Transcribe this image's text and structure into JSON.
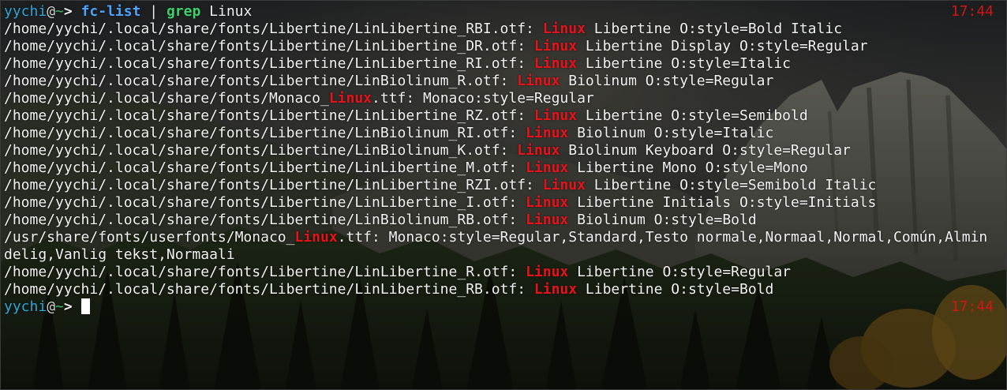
{
  "prompt": {
    "user": "yychi",
    "at": "@",
    "dir": "~",
    "arrow": ">"
  },
  "command": {
    "name": "fc-list",
    "pipe": "|",
    "grep": "grep",
    "arg": "Linux"
  },
  "clock_top": "17:44",
  "clock_bottom": "17:44",
  "output": [
    {
      "pre": "/home/yychi/.local/share/fonts/Libertine/LinLibertine_RBI.otf: ",
      "match": "Linux",
      "post": " Libertine O:style=Bold Italic"
    },
    {
      "pre": "/home/yychi/.local/share/fonts/Libertine/LinLibertine_DR.otf: ",
      "match": "Linux",
      "post": " Libertine Display O:style=Regular"
    },
    {
      "pre": "/home/yychi/.local/share/fonts/Libertine/LinLibertine_RI.otf: ",
      "match": "Linux",
      "post": " Libertine O:style=Italic"
    },
    {
      "pre": "/home/yychi/.local/share/fonts/Libertine/LinBiolinum_R.otf: ",
      "match": "Linux",
      "post": " Biolinum O:style=Regular"
    },
    {
      "pre": "/home/yychi/.local/share/fonts/Monaco_",
      "match": "Linux",
      "post": ".ttf: Monaco:style=Regular"
    },
    {
      "pre": "/home/yychi/.local/share/fonts/Libertine/LinLibertine_RZ.otf: ",
      "match": "Linux",
      "post": " Libertine O:style=Semibold"
    },
    {
      "pre": "/home/yychi/.local/share/fonts/Libertine/LinBiolinum_RI.otf: ",
      "match": "Linux",
      "post": " Biolinum O:style=Italic"
    },
    {
      "pre": "/home/yychi/.local/share/fonts/Libertine/LinBiolinum_K.otf: ",
      "match": "Linux",
      "post": " Biolinum Keyboard O:style=Regular"
    },
    {
      "pre": "/home/yychi/.local/share/fonts/Libertine/LinLibertine_M.otf: ",
      "match": "Linux",
      "post": " Libertine Mono O:style=Mono"
    },
    {
      "pre": "/home/yychi/.local/share/fonts/Libertine/LinLibertine_RZI.otf: ",
      "match": "Linux",
      "post": " Libertine O:style=Semibold Italic"
    },
    {
      "pre": "/home/yychi/.local/share/fonts/Libertine/LinLibertine_I.otf: ",
      "match": "Linux",
      "post": " Libertine Initials O:style=Initials"
    },
    {
      "pre": "/home/yychi/.local/share/fonts/Libertine/LinBiolinum_RB.otf: ",
      "match": "Linux",
      "post": " Biolinum O:style=Bold"
    },
    {
      "pre": "/usr/share/fonts/userfonts/Monaco_",
      "match": "Linux",
      "post": ".ttf: Monaco:style=Regular,Standard,Testo normale,Normaal,Normal,Común,Almin"
    },
    {
      "pre": "delig,Vanlig tekst,Normaali",
      "match": "",
      "post": ""
    },
    {
      "pre": "/home/yychi/.local/share/fonts/Libertine/LinLibertine_R.otf: ",
      "match": "Linux",
      "post": " Libertine O:style=Regular"
    },
    {
      "pre": "/home/yychi/.local/share/fonts/Libertine/LinLibertine_RB.otf: ",
      "match": "Linux",
      "post": " Libertine O:style=Bold"
    }
  ],
  "colors": {
    "prompt_user": "#2ea6d8",
    "prompt_tilde": "#3fbf6a",
    "command": "#4da3ff",
    "grep": "#3fd06a",
    "match": "#e8121b",
    "clock": "#d21616"
  }
}
